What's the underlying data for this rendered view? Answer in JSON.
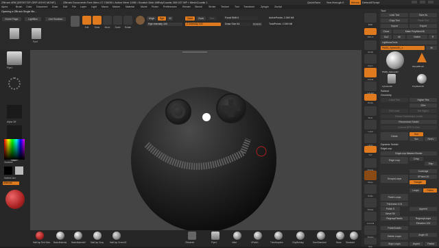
{
  "titlebar": {
    "app": "ZBrush 4R8 [DESKTOP-GRP-0OHS MCNF]",
    "doc": "ZBrush Document",
    "mem": "• Free Mem 17.746GB • Active Mem 1498 • Scratch Disk 48 • ",
    "poly": "PolyCount▸ 269.027 MP • MeshCount▸ 1",
    "quicksave": "QuickSave",
    "seethrough": "See-through 0",
    "menus": "Menus",
    "defaultscript": "DefaultZScript"
  },
  "menubar": {
    "items": [
      "Alpha",
      "Brush",
      "Color",
      "Document",
      "Draw",
      "Edit",
      "File",
      "Layer",
      "Light",
      "Macro",
      "Marker",
      "Material",
      "Movie",
      "Picker",
      "Preferences",
      "Render",
      "Stencil",
      "Stroke",
      "Texture",
      "Tool",
      "Transform",
      "Zplugin",
      "Zscript"
    ]
  },
  "shelf": {
    "notice": "Opening a ZBrush Single file...",
    "homepage": "Home Page",
    "lightbox": "LightBox",
    "liveboolean": "Live Boolean",
    "edit": "Edit",
    "draw": "Draw",
    "move": "Move",
    "scale": "Scale",
    "rotate": "Rotate",
    "mrgb": "Mrgb",
    "rgb": "Rgb",
    "m": "M",
    "zadd": "Zadd",
    "zsub": "Zsub",
    "zcut": "Zcut",
    "rgb_intensity": "Rgb Intensity 100",
    "z_intensity": "Z Intensity 100",
    "focal_shift": "Focal Shift 0",
    "draw_size": "Draw Size 64",
    "dynamic": "Dynamic",
    "active_points": "ActivePoints: 2.069 Mil",
    "total_points": "TotalPoints: 2.069 Mil",
    "thumb_label": "Pye1"
  },
  "left": {
    "brush": "Pipe1",
    "alpha_label": "Alpha Off",
    "texture_label": "Texture Off",
    "material_label": "",
    "gradient": "Gradient",
    "switchcolor": "SwitchColor",
    "alternate": "Alternate"
  },
  "bottom_materials": [
    "MatCap Red Wax",
    "BasicMaterial",
    "BasicMaterial2",
    "MatCap Gray",
    "MatCap Green02",
    "ZModeler",
    "Pipe1",
    "Inflat",
    "hPolish",
    "TrimAdaptive",
    "ClayBuildup",
    "DamStandard",
    "Move",
    "Standard"
  ],
  "rstrip": {
    "items": [
      "BPR",
      "SPix 3",
      "Scroll",
      "Zoom",
      "Actual",
      "AAHalf",
      "Persp",
      "Floor",
      "Local",
      "LSym",
      "Xyz",
      "Frame",
      "Move",
      "Scale",
      "Rotate",
      "Line Fill",
      "PolyF",
      "Transp",
      "Ghost",
      "Dynamic",
      "Solo",
      "Xpose"
    ]
  },
  "rpanel": {
    "tool_title": "Tool",
    "load_tool": "Load Tool",
    "save_as": "Save As",
    "copy_tool": "Copy Tool",
    "paste_tool": "Paste Tool",
    "import": "Import",
    "export": "Export",
    "clone": "Clone",
    "make_polymesh": "Make PolyMesh3D",
    "goz": "GoZ",
    "all": "All",
    "visible": "Visible",
    "r": "R",
    "lightbox_tools": "Lightbox▸Tools",
    "pm3d_name": "PM3D_Sphere3D_1",
    "pm3d_count": "46",
    "thumbs": [
      "PM3D_Sphere3D",
      "Cylinder3D",
      "PolyMesh3D",
      "SimpleBrush"
    ],
    "subtool": "Subtool",
    "geometry": "Geometry",
    "lower_res": "Lower Res",
    "higher_res": "Higher Res",
    "sdiv": "SDiv",
    "del_lower": "Del Lower",
    "del_higher": "Del Higher",
    "freeze_subdiv": "Freeze SubDivision Levels",
    "reconstruct_subdiv": "Reconstruct Subdiv",
    "convert_bpr": "Convert BPR To Geo",
    "divide": "Divide",
    "smt": "Smt",
    "suv": "Suv",
    "reuv": "ReUV",
    "dynamic_subdiv": "Dynamic Subdiv",
    "edgeloop": "EdgeLoop",
    "edgeloop_masked": "EdgeLoop Masked Border",
    "edge_loop": "Edge Loop",
    "crisp": "Crisp",
    "disp": "Disp",
    "coverage": "Coverage",
    "double": "Double",
    "groups_loops": "GroupsLoops",
    "gpolish": "GPolish 20",
    "triangle": "Triangle",
    "loops": "Loops",
    "polish": "Polish",
    "panel_loops": "Panel Loops",
    "thickness": "Thickness 0.01",
    "polish2": "Polish 5",
    "append": "Append",
    "bevel": "Bevel 50",
    "regroup_panels": "RegroupPanels",
    "regroup_loops": "RegroupLoops",
    "elevation": "Elevation 100",
    "polish_subdiv": "PolishSubdiv",
    "delete_loops": "Delete Loops",
    "angle": "Angle 20",
    "align_loops": "Align Loops",
    "aspect": "Aspect",
    "partial": "Partial",
    "fill": "Fill"
  },
  "colors": {
    "accent": "#e07a1f",
    "bg": "#1d1d1d",
    "canvas": "#444444"
  }
}
